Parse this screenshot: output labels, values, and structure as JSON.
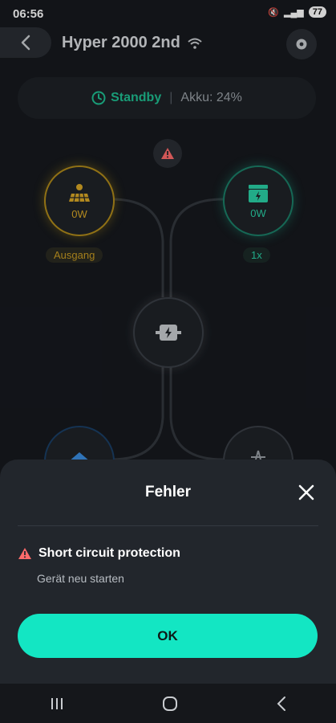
{
  "statusbar": {
    "time": "06:56",
    "battery_level": "77"
  },
  "header": {
    "title": "Hyper 2000 2nd"
  },
  "status": {
    "mode": "Standby",
    "battery": "Akku: 24%"
  },
  "nodes": {
    "solar": {
      "value": "0W",
      "tag": "Ausgang"
    },
    "battery": {
      "value": "0W",
      "tag": "1x"
    }
  },
  "dialog": {
    "title": "Fehler",
    "error_title": "Short circuit protection",
    "error_desc": "Gerät neu starten",
    "ok_label": "OK"
  },
  "colors": {
    "accent": "#13e6c3",
    "standby": "#1fbf92",
    "solar": "#d9a827",
    "error": "#ff6b6b"
  }
}
